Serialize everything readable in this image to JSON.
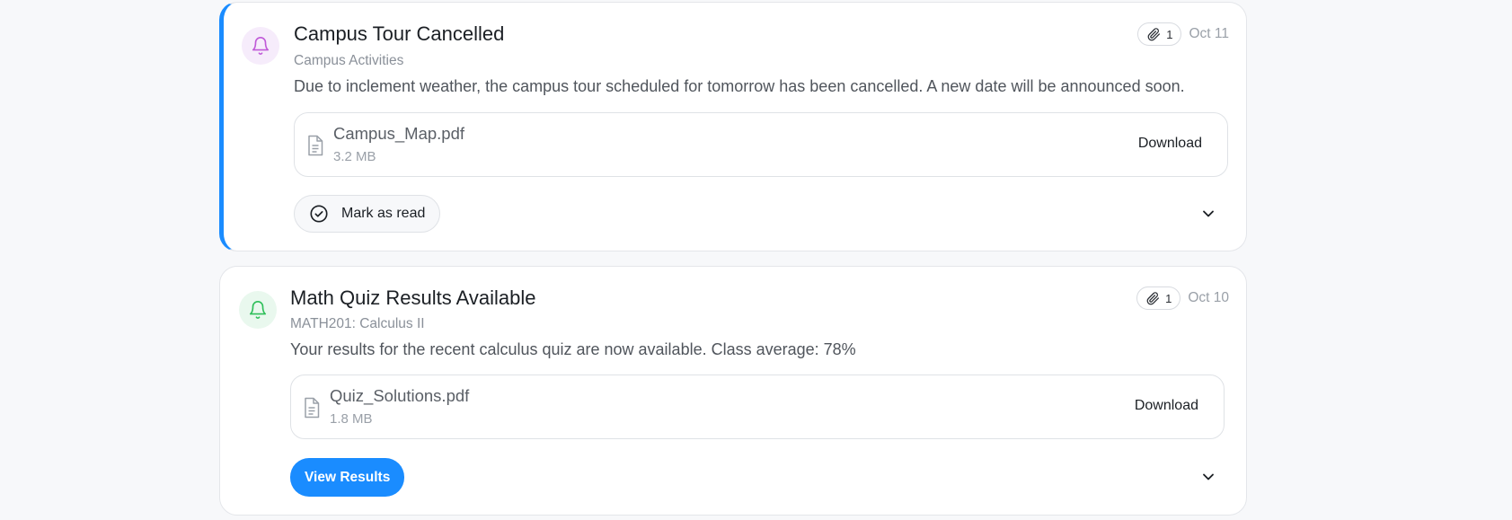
{
  "notifications": [
    {
      "title": "Campus Tour Cancelled",
      "source": "Campus Activities",
      "message": "Due to inclement weather, the campus tour scheduled for tomorrow has been cancelled. A new date will be announced soon.",
      "attachment_count": "1",
      "date": "Oct 11",
      "unread": true,
      "icon": "bell-icon",
      "icon_color": "#c05ad8",
      "attachment": {
        "file_name": "Campus_Map.pdf",
        "file_size": "3.2 MB",
        "download_label": "Download"
      },
      "action_label": "Mark as read"
    },
    {
      "title": "Math Quiz Results Available",
      "source": "MATH201: Calculus II",
      "message": "Your results for the recent calculus quiz are now available. Class average: 78%",
      "attachment_count": "1",
      "date": "Oct 10",
      "unread": false,
      "icon": "bell-icon",
      "icon_color": "#2fbf5a",
      "attachment": {
        "file_name": "Quiz_Solutions.pdf",
        "file_size": "1.8 MB",
        "download_label": "Download"
      },
      "action_label": "View Results"
    }
  ],
  "colors": {
    "accent": "#1a8cff",
    "unread_border": "#1a8cff"
  }
}
